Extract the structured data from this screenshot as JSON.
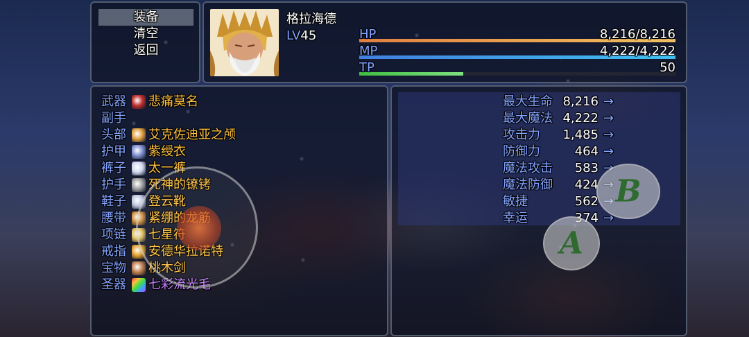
{
  "commands": [
    {
      "label": "装备",
      "selected": true
    },
    {
      "label": "清空",
      "selected": false
    },
    {
      "label": "返回",
      "selected": false
    }
  ],
  "actor": {
    "name": "格拉海德",
    "level_label": "LV",
    "level": "45"
  },
  "gauges": [
    {
      "label": "HP",
      "value": "8,216/8,216",
      "ratio": 1.0,
      "color_a": "#e08040",
      "color_b": "#f0c060"
    },
    {
      "label": "MP",
      "value": "4,222/4,222",
      "ratio": 1.0,
      "color_a": "#4080e0",
      "color_b": "#40c0f0"
    },
    {
      "label": "TP",
      "value": "50",
      "ratio": 0.33,
      "color_a": "#40c040",
      "color_b": "#80e080"
    }
  ],
  "equipment": [
    {
      "slot": "武器",
      "item": "悲痛莫名",
      "icon": "sword-icon",
      "icon_color": "#c03030"
    },
    {
      "slot": "副手",
      "item": "",
      "icon": "",
      "icon_color": ""
    },
    {
      "slot": "头部",
      "item": "艾克佐迪亚之颅",
      "icon": "skull-helm-icon",
      "icon_color": "#e0a040"
    },
    {
      "slot": "护甲",
      "item": "紫绶衣",
      "icon": "robe-icon",
      "icon_color": "#8090d0"
    },
    {
      "slot": "裤子",
      "item": "太一裤",
      "icon": "pants-icon",
      "icon_color": "#d0d8f0"
    },
    {
      "slot": "护手",
      "item": "死神的镣铐",
      "icon": "shackles-icon",
      "icon_color": "#a0a0a0"
    },
    {
      "slot": "鞋子",
      "item": "登云靴",
      "icon": "boots-icon",
      "icon_color": "#c0c8e0"
    },
    {
      "slot": "腰带",
      "item": "紧绷的龙筋",
      "icon": "belt-icon",
      "icon_color": "#d09040"
    },
    {
      "slot": "项链",
      "item": "七星符",
      "icon": "necklace-icon",
      "icon_color": "#e0c060"
    },
    {
      "slot": "戒指",
      "item": "安德华拉诺特",
      "icon": "ring-icon",
      "icon_color": "#e0a030"
    },
    {
      "slot": "宝物",
      "item": "桃木剑",
      "icon": "wooden-sword-icon",
      "icon_color": "#c08050"
    },
    {
      "slot": "圣器",
      "item": "七彩流光毛",
      "icon": "rainbow-feather-icon",
      "icon_color": "#c060e0"
    }
  ],
  "params": [
    {
      "name": "最大生命",
      "value": "8,216"
    },
    {
      "name": "最大魔法",
      "value": "4,222"
    },
    {
      "name": "攻击力",
      "value": "1,485"
    },
    {
      "name": "防御力",
      "value": "464"
    },
    {
      "name": "魔法攻击",
      "value": "583"
    },
    {
      "name": "魔法防御",
      "value": "424"
    },
    {
      "name": "敏捷",
      "value": "562"
    },
    {
      "name": "幸运",
      "value": "374"
    }
  ],
  "param_arrow": "→",
  "virtual_buttons": {
    "a": "A",
    "b": "B"
  },
  "colors": {
    "system": "#84a4ff",
    "item": "#ffc040",
    "window_border": "#5f697d"
  }
}
